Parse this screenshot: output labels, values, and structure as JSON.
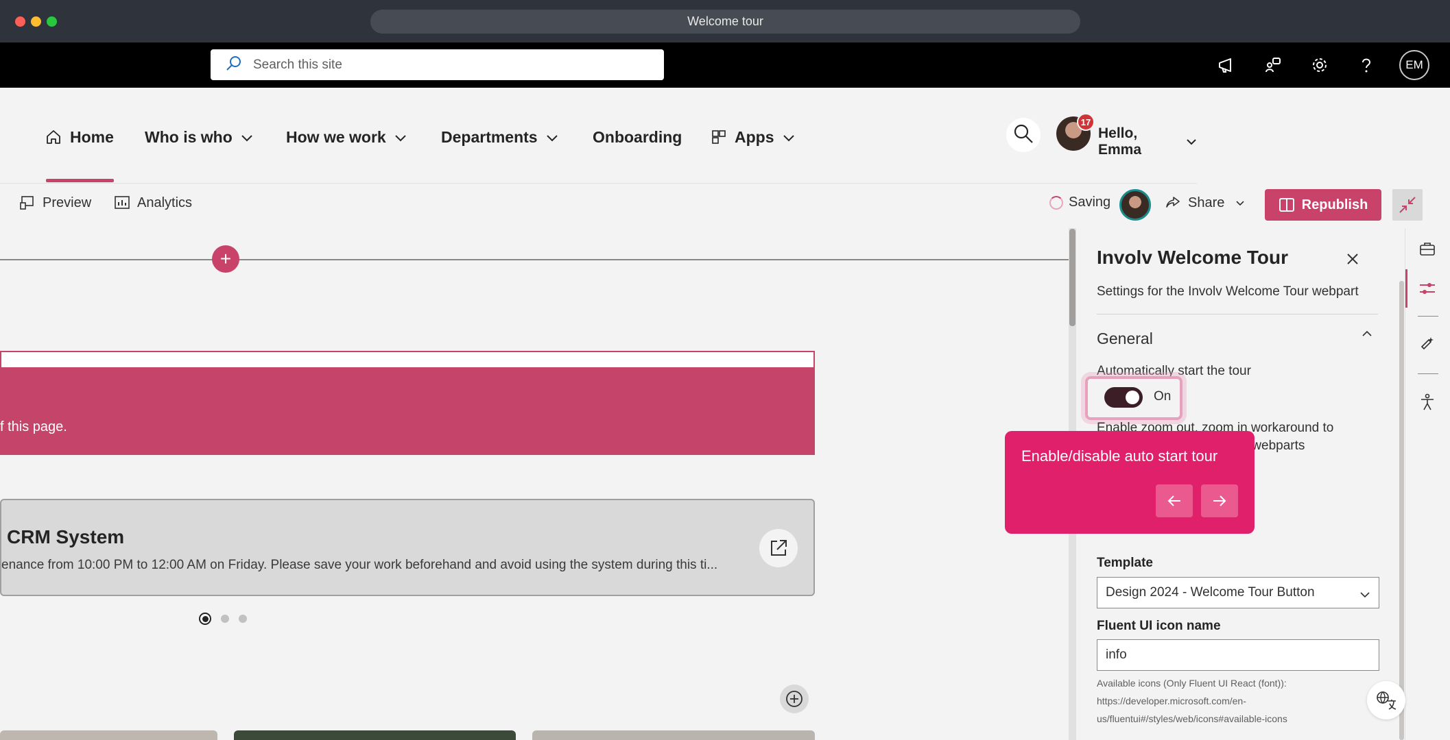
{
  "window": {
    "title": "Welcome tour"
  },
  "suite_bar": {
    "search_placeholder": "Search this site",
    "icons": [
      "megaphone-icon",
      "share-feedback-icon",
      "settings-gear-icon",
      "help-icon"
    ],
    "avatar_initials": "EM"
  },
  "site_nav": {
    "items": [
      {
        "label": "Home",
        "icon": "home-icon",
        "selected": true
      },
      {
        "label": "Who is who",
        "has_dropdown": true
      },
      {
        "label": "How we work",
        "has_dropdown": true
      },
      {
        "label": "Departments",
        "has_dropdown": true
      },
      {
        "label": "Onboarding"
      },
      {
        "label": "Apps",
        "icon": "apps-grid-icon",
        "has_dropdown": true
      }
    ],
    "notification_count": "17",
    "greeting": "Hello, Emma"
  },
  "command_bar": {
    "preview": "Preview",
    "analytics": "Analytics",
    "status": "Saving",
    "share": "Share",
    "republish": "Republish"
  },
  "canvas": {
    "banner_text": "f this page.",
    "news": {
      "title": "CRM System",
      "description": "enance from 10:00 PM to 12:00 AM on Friday. Please save your work beforehand and avoid using the system during this ti..."
    },
    "carousel": {
      "count": 3,
      "active_index": 0
    }
  },
  "property_pane": {
    "title": "Involv Welcome Tour",
    "description": "Settings for the Involv Welcome Tour webpart",
    "group_title": "General",
    "auto_start_label": "Automatically start the tour",
    "toggle_state": "On",
    "zoom_label_line1": "Enable zoom out, zoom in workaround to",
    "zoom_label_line2": "all webparts",
    "template_label": "Template",
    "template_value": "Design 2024 - Welcome Tour Button",
    "icon_label": "Fluent UI icon name",
    "icon_value": "info",
    "help_line1": "Available icons (Only Fluent UI React (font)):",
    "help_line2": "https://developer.microsoft.com/en-",
    "help_line3": "us/fluentui#/styles/web/icons#available-icons"
  },
  "tour_popover": {
    "text": "Enable/disable auto start tour"
  },
  "colors": {
    "accent": "#c8426a",
    "tour": "#e0206a",
    "suite_bar": "#000000"
  }
}
